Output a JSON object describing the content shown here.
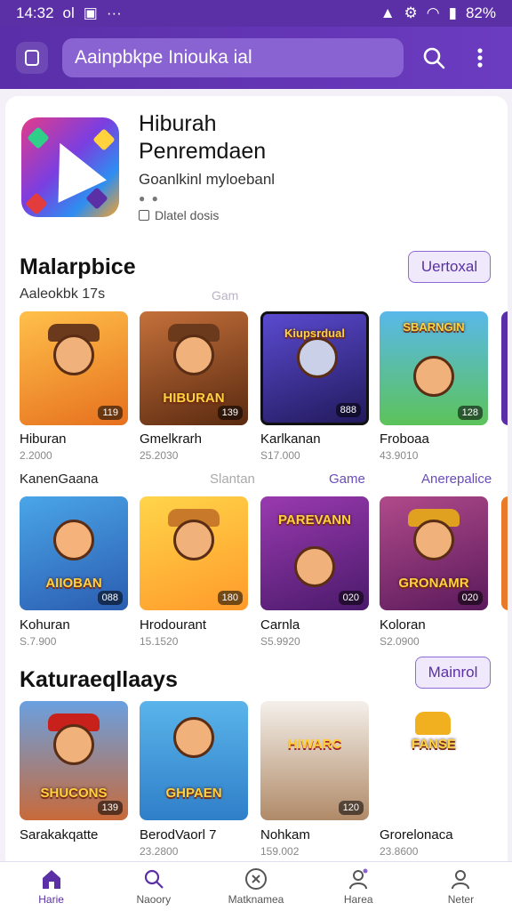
{
  "status": {
    "time": "14:32",
    "extra": "ol",
    "battery": "82%"
  },
  "search": {
    "placeholder": "Aainpbkpe Iniouka ial"
  },
  "hero": {
    "title": "Hiburah Penremdaen",
    "subtitle": "Goanlkinl myloebanl",
    "meta": "Dlatel dosis"
  },
  "section1": {
    "title": "Malarpbice",
    "subtitle": "Aaleokbk 17s",
    "faint": "Gam",
    "button": "Uertoxal",
    "games": [
      {
        "name": "Hiburan",
        "num": "2.2000",
        "badge": "119",
        "art": "",
        "bg": "#f59a2a"
      },
      {
        "name": "Gmelkrarh",
        "num": "25.2030",
        "badge": "139",
        "art": "HIBURAN",
        "bg": "#7a3e1a"
      },
      {
        "name": "Karlkanan",
        "num": "S17.000",
        "badge": "888",
        "art": "Kiupsrdual",
        "bg": "#3a2f8a"
      },
      {
        "name": "Froboaa",
        "num": "43.9010",
        "badge": "128",
        "art": "SBARNGIN",
        "bg": "#3ea4d8"
      }
    ]
  },
  "row2": {
    "label": "KanenGaana",
    "faint": "Slantan",
    "link1": "Game",
    "link2": "Anerepalice",
    "games": [
      {
        "name": "Kohuran",
        "num": "S.7.900",
        "badge": "088",
        "art": "AIIOBAN",
        "bg": "#3f8fd6"
      },
      {
        "name": "Hrodourant",
        "num": "15.1520",
        "badge": "180",
        "art": "",
        "bg": "#f5c43a"
      },
      {
        "name": "Carnla",
        "num": "S5.9920",
        "badge": "020",
        "art": "PAREVANN",
        "bg": "#7a2b8c"
      },
      {
        "name": "Koloran",
        "num": "S2.0900",
        "badge": "020",
        "art": "GRONAMR",
        "bg": "#6a2a7c"
      }
    ]
  },
  "section3": {
    "title": "Katuraeqllaays",
    "button": "Mainrol",
    "games": [
      {
        "name": "Sarakakqatte",
        "num": "",
        "badge": "139",
        "art": "SHUCONS",
        "bg": "#d86a3a"
      },
      {
        "name": "BerodVaorl 7",
        "num": "23.2800",
        "badge": "",
        "art": "GHPAEN",
        "bg": "#5aa8e0"
      },
      {
        "name": "Nohkam",
        "num": "159.002",
        "badge": "120",
        "art": "HIWARC",
        "bg": "#b8a08a"
      },
      {
        "name": "Grorelonaca",
        "num": "23.8600",
        "badge": "",
        "art": "FANSE",
        "bg": "#ffffff"
      }
    ]
  },
  "nav": [
    {
      "label": "Harie",
      "icon": "home-icon"
    },
    {
      "label": "Naoory",
      "icon": "search-icon"
    },
    {
      "label": "Matknamea",
      "icon": "gamepad-icon"
    },
    {
      "label": "Harea",
      "icon": "profile-icon"
    },
    {
      "label": "Neter",
      "icon": "user-icon"
    }
  ],
  "colors": {
    "primary": "#5b2fa6",
    "accent": "#8a63d2"
  }
}
